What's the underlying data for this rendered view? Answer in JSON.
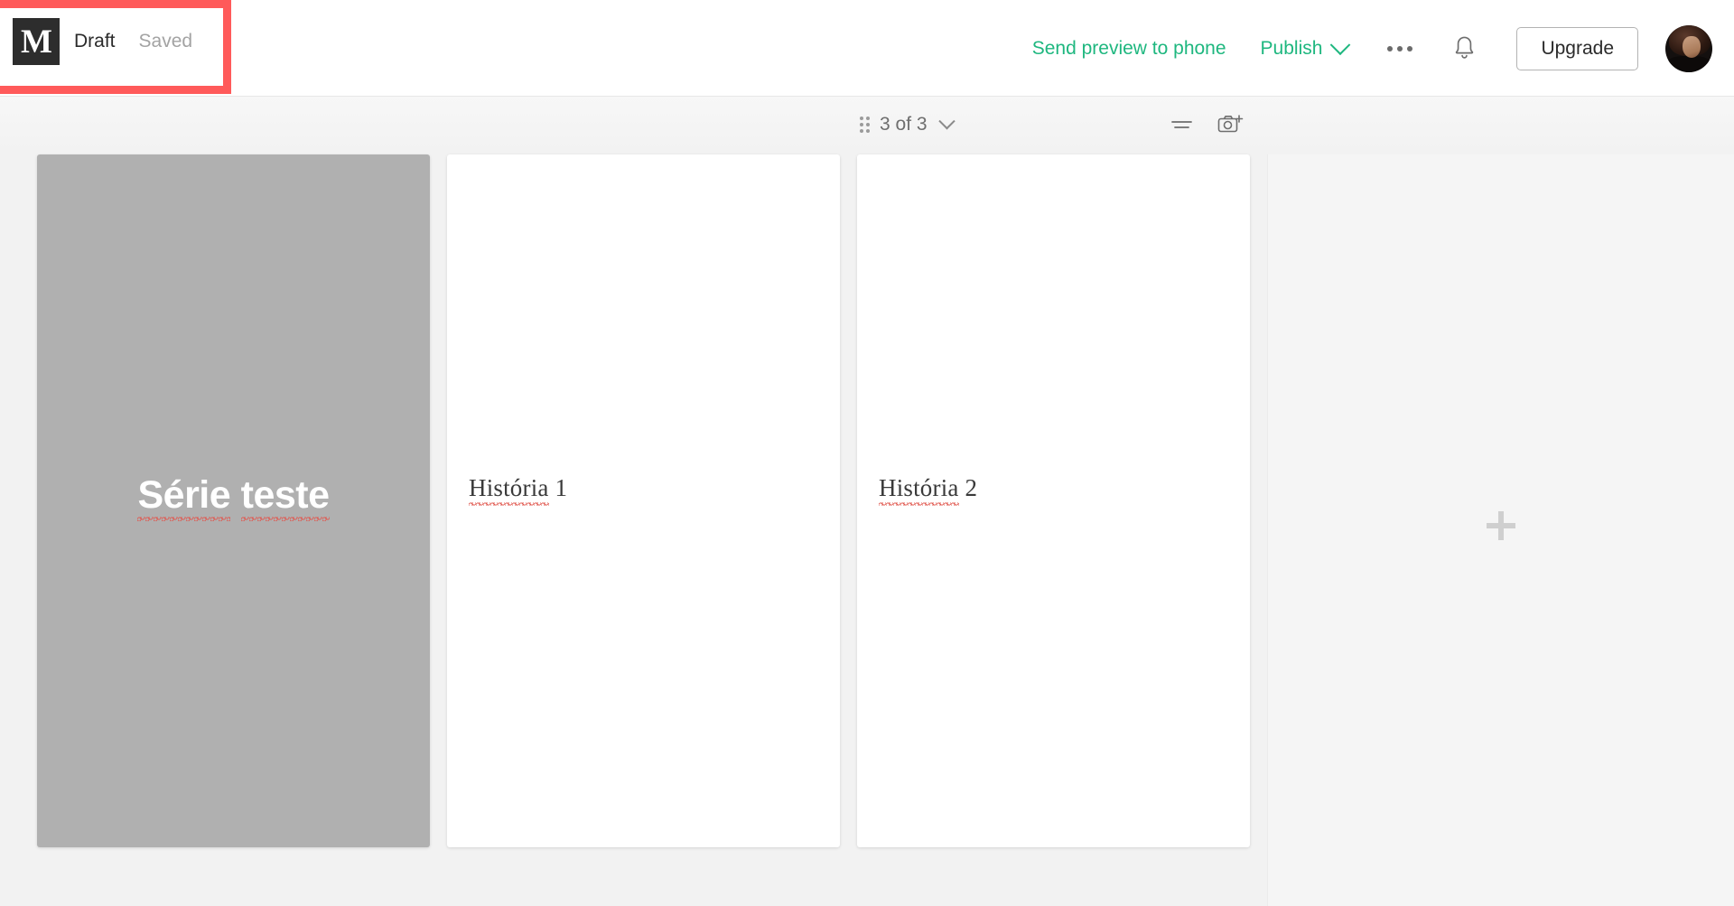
{
  "header": {
    "logo_letter": "M",
    "status_title": "Draft",
    "saved_label": "Saved",
    "send_preview_label": "Send preview to phone",
    "publish_label": "Publish",
    "more_icon": "ellipsis-icon",
    "notifications_icon": "bell-icon",
    "upgrade_label": "Upgrade",
    "avatar_icon": "user-avatar",
    "accent_color": "#1eb77f",
    "highlight_color": "#ff5a5a"
  },
  "toolbar": {
    "grip_icon": "drag-handle-icon",
    "counter_label": "3 of 3",
    "counter_chevron_icon": "chevron-down-icon",
    "align_icon": "text-align-icon",
    "add_photo_icon": "camera-add-icon"
  },
  "cards": [
    {
      "type": "cover",
      "title": "Série teste",
      "spellcheck_words": [
        "Série",
        "teste"
      ],
      "background_color": "#b0b0b0"
    },
    {
      "type": "page",
      "title_spelled": "História",
      "title_rest": " 1",
      "background_color": "#ffffff"
    },
    {
      "type": "page",
      "title_spelled": "História",
      "title_rest": " 2",
      "background_color": "#ffffff"
    }
  ],
  "add_pane": {
    "plus_icon": "plus-icon"
  }
}
